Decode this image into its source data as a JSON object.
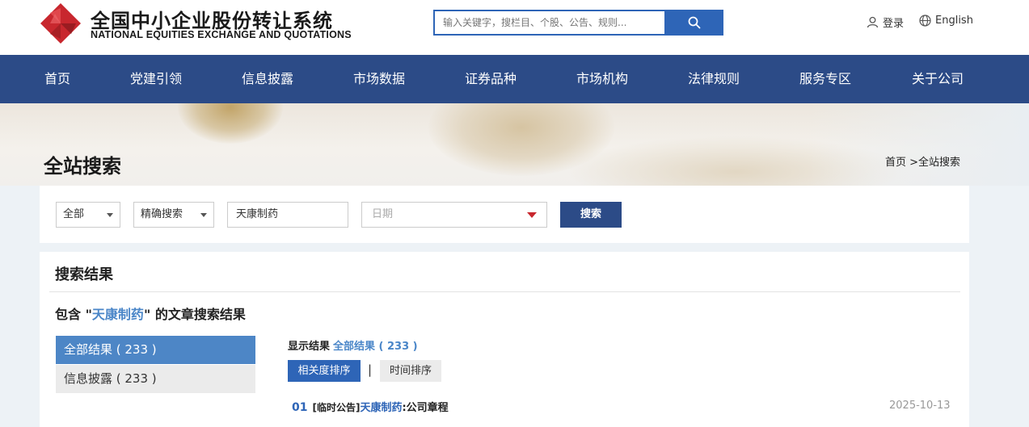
{
  "header": {
    "brand_cn": "全国中小企业股份转让系统",
    "brand_en": "NATIONAL EQUITIES EXCHANGE AND QUOTATIONS",
    "search_placeholder": "输入关键字，搜栏目、个股、公告、规则...",
    "login_label": "登录",
    "lang_label": "English"
  },
  "nav": {
    "items": [
      "首页",
      "党建引领",
      "信息披露",
      "市场数据",
      "证券品种",
      "市场机构",
      "法律规则",
      "服务专区",
      "关于公司"
    ]
  },
  "banner": {
    "title": "全站搜索",
    "breadcrumb": "首页 >全站搜索"
  },
  "filter": {
    "scope": "全部",
    "mode": "精确搜索",
    "keyword": "天康制药",
    "date_placeholder": "日期",
    "search_label": "搜索"
  },
  "results": {
    "title": "搜索结果",
    "sub_prefix": "包含 \"",
    "keyword": "天康制药",
    "sub_suffix": "\" 的文章搜索结果",
    "categories": [
      {
        "label": "全部结果 ( 233 )"
      },
      {
        "label": "信息披露 ( 233 )"
      }
    ],
    "shown_label": "显示结果",
    "shown_count": "全部结果 ( 233 )",
    "sort_relevance": "相关度排序",
    "sort_sep": "|",
    "sort_time": "时间排序",
    "items": [
      {
        "num": "01",
        "tag": "[临时公告]",
        "company": "天康制药",
        "title": ":公司章程",
        "date": "2025-10-13"
      }
    ]
  },
  "colors": {
    "nav_bg": "#2c4b87",
    "accent_blue": "#2e65b7",
    "link_blue": "#4a86c8",
    "logo_red": "#c8272e"
  }
}
